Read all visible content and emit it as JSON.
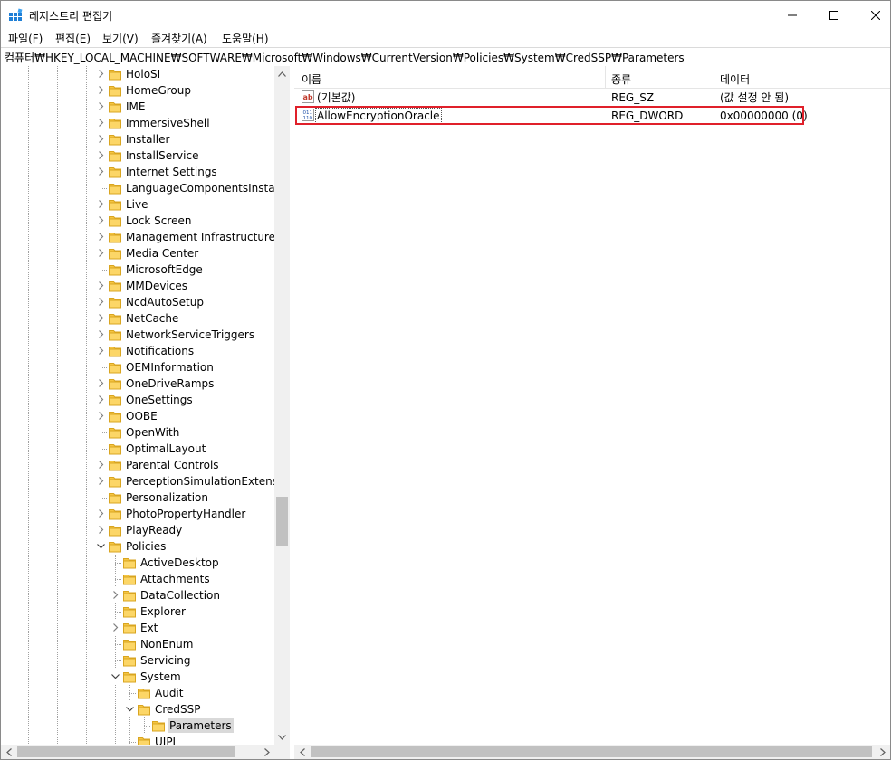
{
  "window": {
    "title": "레지스트리 편집기"
  },
  "menu": [
    "파일(F)",
    "편집(E)",
    "보기(V)",
    "즐겨찾기(A)",
    "도움말(H)"
  ],
  "address": "컴퓨터₩HKEY_LOCAL_MACHINE₩SOFTWARE₩Microsoft₩Windows₩CurrentVersion₩Policies₩System₩CredSSP₩Parameters",
  "tree": [
    {
      "label": "HoloSI",
      "expander": true
    },
    {
      "label": "HomeGroup",
      "expander": true
    },
    {
      "label": "IME",
      "expander": true
    },
    {
      "label": "ImmersiveShell",
      "expander": true
    },
    {
      "label": "Installer",
      "expander": true
    },
    {
      "label": "InstallService",
      "expander": true
    },
    {
      "label": "Internet Settings",
      "expander": true
    },
    {
      "label": "LanguageComponentsInstaller",
      "expander": false
    },
    {
      "label": "Live",
      "expander": true
    },
    {
      "label": "Lock Screen",
      "expander": true
    },
    {
      "label": "Management Infrastructure",
      "expander": true
    },
    {
      "label": "Media Center",
      "expander": true
    },
    {
      "label": "MicrosoftEdge",
      "expander": false
    },
    {
      "label": "MMDevices",
      "expander": true
    },
    {
      "label": "NcdAutoSetup",
      "expander": true
    },
    {
      "label": "NetCache",
      "expander": true
    },
    {
      "label": "NetworkServiceTriggers",
      "expander": true
    },
    {
      "label": "Notifications",
      "expander": true
    },
    {
      "label": "OEMInformation",
      "expander": false
    },
    {
      "label": "OneDriveRamps",
      "expander": true
    },
    {
      "label": "OneSettings",
      "expander": true
    },
    {
      "label": "OOBE",
      "expander": true
    },
    {
      "label": "OpenWith",
      "expander": false
    },
    {
      "label": "OptimalLayout",
      "expander": false
    },
    {
      "label": "Parental Controls",
      "expander": true
    },
    {
      "label": "PerceptionSimulationExtensions",
      "expander": true
    },
    {
      "label": "Personalization",
      "expander": false
    },
    {
      "label": "PhotoPropertyHandler",
      "expander": true
    },
    {
      "label": "PlayReady",
      "expander": true
    },
    {
      "label": "Policies",
      "expander": true,
      "expanded": true
    },
    {
      "label": "ActiveDesktop",
      "expander": false,
      "level": 1
    },
    {
      "label": "Attachments",
      "expander": false,
      "level": 1
    },
    {
      "label": "DataCollection",
      "expander": true,
      "level": 1
    },
    {
      "label": "Explorer",
      "expander": false,
      "level": 1
    },
    {
      "label": "Ext",
      "expander": true,
      "level": 1
    },
    {
      "label": "NonEnum",
      "expander": false,
      "level": 1
    },
    {
      "label": "Servicing",
      "expander": false,
      "level": 1
    },
    {
      "label": "System",
      "expander": true,
      "expanded": true,
      "level": 1
    },
    {
      "label": "Audit",
      "expander": false,
      "level": 2
    },
    {
      "label": "CredSSP",
      "expander": true,
      "expanded": true,
      "level": 2
    },
    {
      "label": "Parameters",
      "expander": false,
      "level": 3,
      "selected": true
    },
    {
      "label": "UIPI",
      "expander": false,
      "level": 2
    }
  ],
  "list": {
    "columns": [
      "이름",
      "종류",
      "데이터"
    ],
    "rows": [
      {
        "icon": "string-value-icon",
        "name": "(기본값)",
        "type": "REG_SZ",
        "data": "(값 설정 안 됨)"
      },
      {
        "icon": "dword-value-icon",
        "name": "AllowEncryptionOracle",
        "type": "REG_DWORD",
        "data": "0x00000000 (0)",
        "focused": true
      }
    ]
  },
  "colors": {
    "highlight_box": "#e0202a",
    "folder": "#f5c542",
    "selection": "#d9d9d9"
  }
}
